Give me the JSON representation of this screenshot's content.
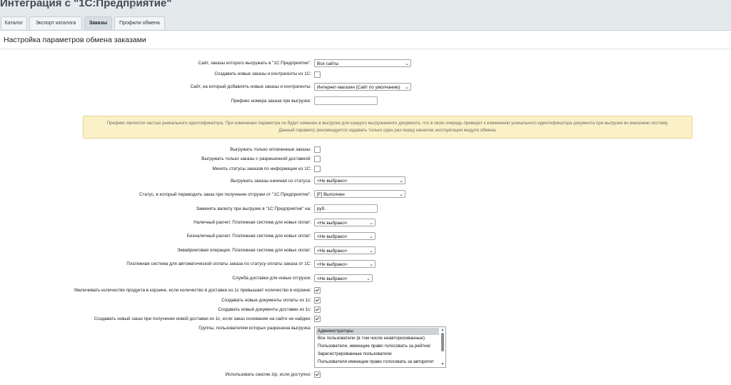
{
  "header": {
    "title": "Интеграция с \"1С:Предприятие\""
  },
  "tabs": [
    {
      "label": "Каталог"
    },
    {
      "label": "Экспорт каталога"
    },
    {
      "label": "Заказы"
    },
    {
      "label": "Профили обмена"
    }
  ],
  "panel": {
    "title": "Настройка параметров обмена заказами"
  },
  "fields": {
    "site_label": "Сайт, заказы которого выгружать в \"1С:Предприятие\":",
    "site_value": "Все сайты",
    "create_new_label": "Создавать новые заказы и контрагенты из 1С:",
    "target_site_label": "Сайт, на который добавлять новые заказы и контрагенты:",
    "target_site_value": "Интернет-магазин (Сайт по умолчанию)",
    "prefix_label": "Префикс номера заказа при выгрузке:",
    "prefix_value": "",
    "note_line1": "Префикс является частью уникального идентификатора. При изменении параметра он будет изменен в выгрузке для каждого выгружаемого документа, что в свою очередь приведет к изменению уникального идентификатора документа при выгрузке во внешнюю систему.",
    "note_line2": "Данный параметр рекомендуется задавать только один раз перед началом эксплуатации модуля обмена.",
    "paid_only_label": "Выгружать только оплаченные заказы:",
    "delivery_allowed_label": "Выгружать только заказы с разрешенной доставкой:",
    "change_status_label": "Менять статусы заказов по информации из 1С:",
    "from_status_label": "Выгружать заказы начиная со статуса:",
    "from_status_value": "<Не выбрано>",
    "shipped_status_label": "Статус, в который переводить заказ при получении отгрузки от \"1С:Предприятие\":",
    "shipped_status_value": "[F] Выполнен",
    "currency_label": "Заменять валюту при выгрузке в \"1С:Предприятие\" на:",
    "currency_value": "руб.",
    "cash_label": "Наличный расчет. Платежная система для новых оплат:",
    "cash_value": "<Не выбрано>",
    "cashless_label": "Безналичный расчет. Платежная система для новых оплат:",
    "cashless_value": "<Не выбрано>",
    "acquiring_label": "Эквайринговая операция. Платежная система для новых оплат:",
    "acquiring_value": "<Не выбрано>",
    "auto_pay_label": "Платежная система для автоматической оплаты заказа по статусу оплаты заказа от 1С:",
    "auto_pay_value": "<Не выбрано>",
    "delivery_service_label": "Служба доставки для новых отгрузок:",
    "delivery_service_value": "<Не выбрано>",
    "increase_qty_label": "Увеличивать количество продукта в корзине, если количество в доставке из 1с превышает количество в корзине:",
    "create_payments_label": "Создавать новые документы оплаты из 1с:",
    "create_deliveries_label": "Создавать новый документы доставки из 1с:",
    "create_order_label": "Создавать новый заказ при получении новой доставки из 1с, если заказ основание на сайте не найден:",
    "groups_label": "Группы, пользователям которых разрешена выгрузка:",
    "groups": [
      {
        "label": "Администраторы"
      },
      {
        "label": "Все пользователи (в том числе неавторизованные)"
      },
      {
        "label": "Пользователи, имеющие право голосовать за рейтинг"
      },
      {
        "label": "Зарегистрированные пользователи"
      },
      {
        "label": "Пользователи имеющие право голосовать за авторитет"
      }
    ],
    "zip_label": "Использовать сжатие zip, если доступно:"
  },
  "checkbox_states": {
    "create_new": false,
    "paid_only": false,
    "delivery_allowed": false,
    "change_status": false,
    "increase_qty": true,
    "create_payments": true,
    "create_deliveries": true,
    "create_order": true,
    "zip": true
  },
  "arrow_glyph": "⌄"
}
